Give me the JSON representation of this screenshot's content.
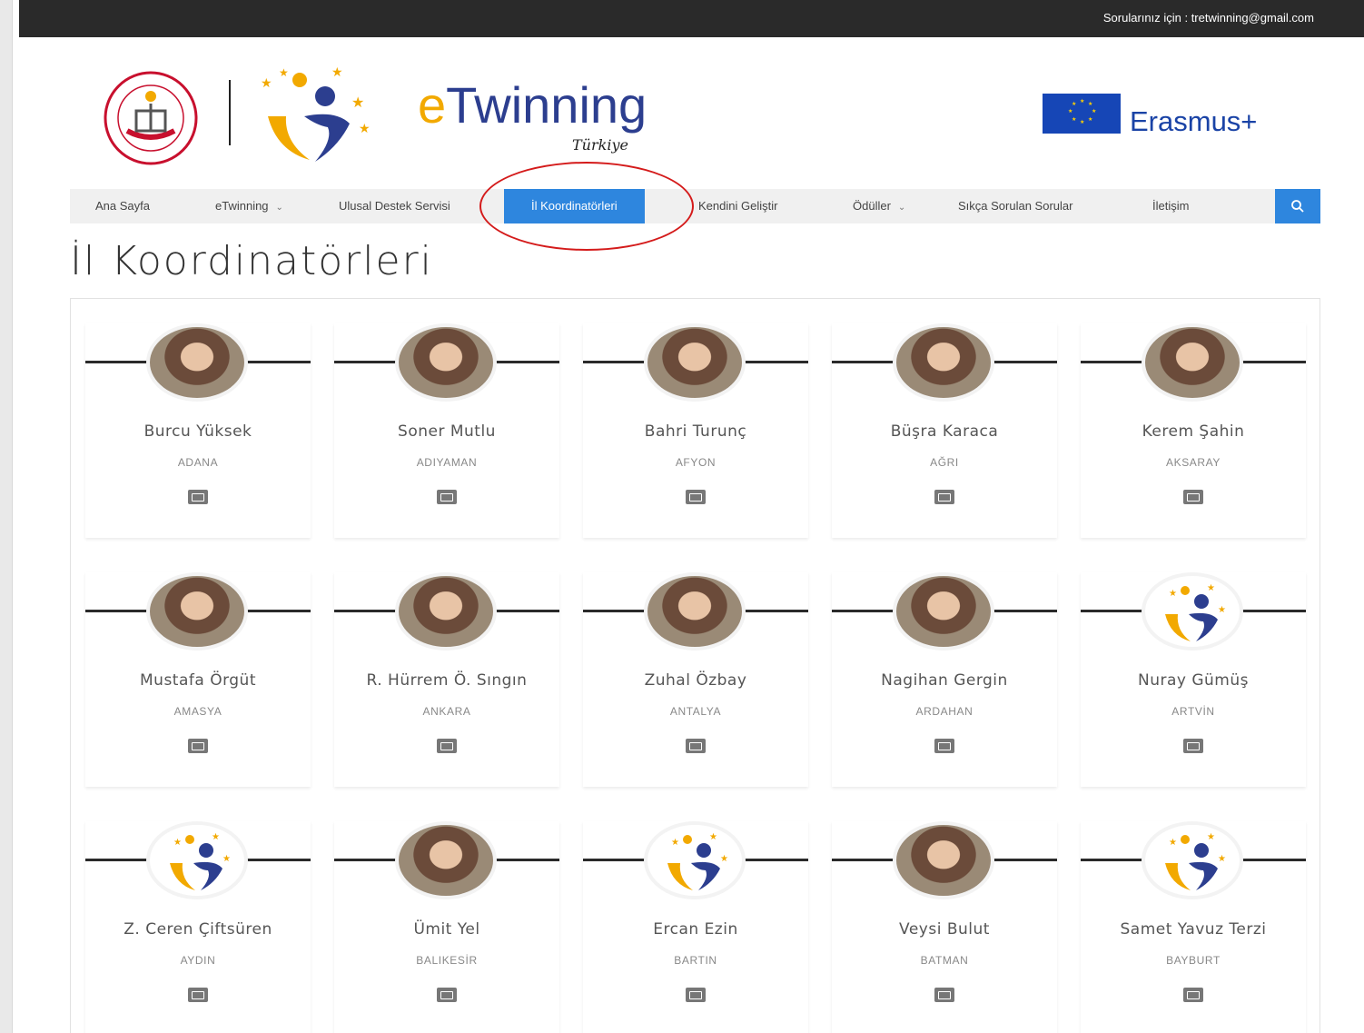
{
  "topbar": {
    "text": "Sorularınız için : tretwinning@gmail.com"
  },
  "header": {
    "etwinning_logo_text": "eTwinning",
    "etwinning_logo_sub": "Türkiye",
    "erasmus_text": "Erasmus+"
  },
  "nav": {
    "items": [
      {
        "label": "Ana Sayfa"
      },
      {
        "label": "eTwinning"
      },
      {
        "label": "Ulusal Destek Servisi"
      },
      {
        "label": "İl Koordinatörleri",
        "active": true
      },
      {
        "label": "Kendini Geliştir"
      },
      {
        "label": "Ödüller"
      },
      {
        "label": "Sıkça Sorulan Sorular"
      },
      {
        "label": "İletişim"
      }
    ],
    "search_icon": "search-icon",
    "active_color": "#2e86de"
  },
  "page": {
    "title": "İl Koordinatörleri"
  },
  "coordinators": [
    {
      "name": "Burcu Yüksek",
      "city": "ADANA"
    },
    {
      "name": "Soner Mutlu",
      "city": "ADIYAMAN"
    },
    {
      "name": "Bahri Turunç",
      "city": "AFYON"
    },
    {
      "name": "Büşra Karaca",
      "city": "AĞRI"
    },
    {
      "name": "Kerem Şahin",
      "city": "AKSARAY"
    },
    {
      "name": "Mustafa Örgüt",
      "city": "AMASYA"
    },
    {
      "name": "R. Hürrem Ö. Sıngın",
      "city": "ANKARA"
    },
    {
      "name": "Zuhal Özbay",
      "city": "ANTALYA"
    },
    {
      "name": "Nagihan Gergin",
      "city": "ARDAHAN"
    },
    {
      "name": "Nuray Gümüş",
      "city": "ARTVİN"
    },
    {
      "name": "Z. Ceren Çiftsüren",
      "city": "AYDIN"
    },
    {
      "name": "Ümit Yel",
      "city": "BALIKESİR"
    },
    {
      "name": "Ercan Ezin",
      "city": "BARTIN"
    },
    {
      "name": "Veysi Bulut",
      "city": "BATMAN"
    },
    {
      "name": "Samet Yavuz Terzi",
      "city": "BAYBURT"
    }
  ]
}
